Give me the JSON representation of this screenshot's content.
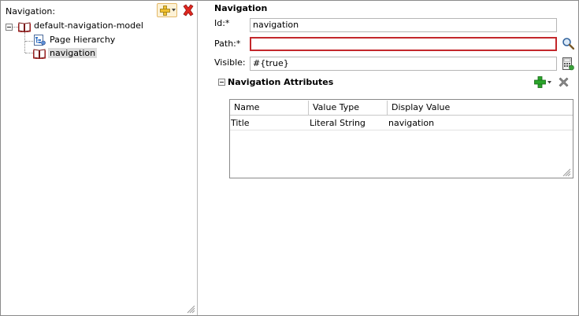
{
  "left_panel": {
    "title": "Navigation:",
    "tree": {
      "root_label": "default-navigation-model",
      "child_page_hierarchy": "Page Hierarchy",
      "child_navigation": "navigation"
    }
  },
  "right_panel": {
    "section_title": "Navigation",
    "fields": {
      "id_label": "Id:*",
      "id_value": "navigation",
      "path_label": "Path:*",
      "path_value": "",
      "visible_label": "Visible:",
      "visible_value": "#{true}"
    },
    "attributes": {
      "title": "Navigation Attributes",
      "columns": [
        "Name",
        "Value Type",
        "Display Value"
      ],
      "rows": [
        [
          "Title",
          "Literal String",
          "navigation"
        ]
      ]
    }
  },
  "colors": {
    "error_border": "#c3272b",
    "add_green": "#2aa52a",
    "delete_red": "#d01f1f",
    "selection": "#dcdcdc"
  },
  "icons": [
    "add-icon",
    "delete-icon",
    "book-icon",
    "page-hierarchy-icon",
    "search-icon",
    "expression-builder-icon"
  ]
}
